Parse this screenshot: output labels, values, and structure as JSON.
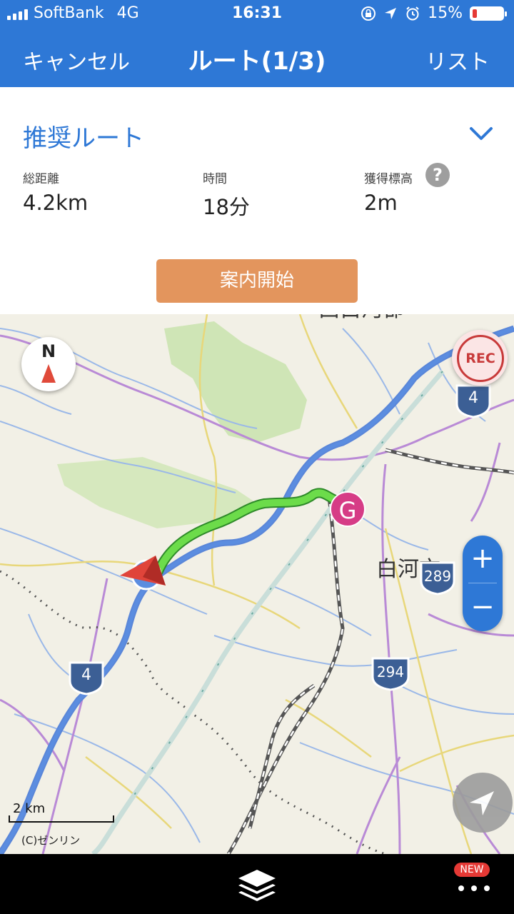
{
  "status": {
    "carrier": "SoftBank",
    "network": "4G",
    "time": "16:31",
    "battery": "15%",
    "battery_level": 0.15
  },
  "nav": {
    "cancel": "キャンセル",
    "title": "ルート(1/3)",
    "list": "リスト"
  },
  "route": {
    "name": "推奨ルート",
    "stats": [
      {
        "label": "総距離",
        "value": "4.2km"
      },
      {
        "label": "時間",
        "value": "18分"
      },
      {
        "label": "獲得標高",
        "value": "2m"
      }
    ],
    "help": "?",
    "start_button": "案内開始"
  },
  "map": {
    "compass": "N",
    "rec": "REC",
    "goal": "G",
    "zoom_in": "+",
    "zoom_out": "−",
    "scale": "2 km",
    "copyright": "(C)ゼンリン",
    "places": [
      "西白河郡",
      "白河市"
    ],
    "routes": [
      "4",
      "4",
      "289",
      "294"
    ]
  },
  "bottom": {
    "new_badge": "NEW"
  },
  "colors": {
    "header": "#2e78d6",
    "start_button": "#e3955d",
    "route_line": "#6cdc4a",
    "goal": "#d63c86"
  }
}
